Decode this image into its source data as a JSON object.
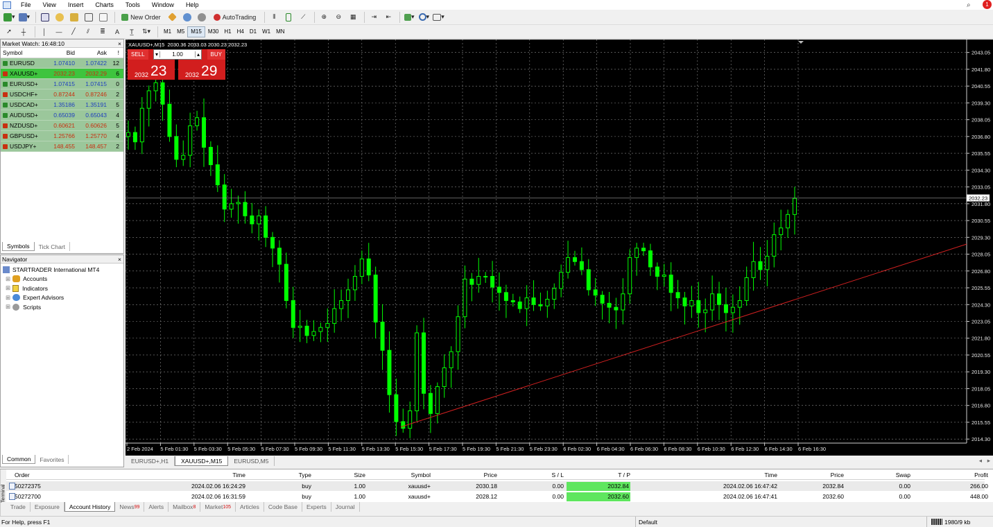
{
  "menu": [
    "File",
    "View",
    "Insert",
    "Charts",
    "Tools",
    "Window",
    "Help"
  ],
  "toolbar": {
    "new_order": "New Order",
    "autotrading": "AutoTrading"
  },
  "drawing_tools": {
    "text_tool": "A"
  },
  "timeframes": [
    "M1",
    "M5",
    "M15",
    "M30",
    "H1",
    "H4",
    "D1",
    "W1",
    "MN"
  ],
  "market_watch": {
    "title": "Market Watch: 16:48:10",
    "columns": [
      "Symbol",
      "Bid",
      "Ask",
      "!"
    ],
    "rows": [
      {
        "symbol": "EURUSD",
        "bid": "1.07410",
        "ask": "1.07422",
        "spread": "12",
        "bidc": "#1f3fbf",
        "askc": "#1f3fbf",
        "hl": false
      },
      {
        "symbol": "XAUUSD+",
        "bid": "2032.23",
        "ask": "2032.29",
        "spread": "6",
        "bidc": "#c83010",
        "askc": "#c83010",
        "hl": true
      },
      {
        "symbol": "EURUSD+",
        "bid": "1.07415",
        "ask": "1.07415",
        "spread": "0",
        "bidc": "#1f3fbf",
        "askc": "#1f3fbf",
        "hl": false
      },
      {
        "symbol": "USDCHF+",
        "bid": "0.87244",
        "ask": "0.87246",
        "spread": "2",
        "bidc": "#c83010",
        "askc": "#c83010",
        "hl": false
      },
      {
        "symbol": "USDCAD+",
        "bid": "1.35186",
        "ask": "1.35191",
        "spread": "5",
        "bidc": "#1f3fbf",
        "askc": "#1f3fbf",
        "hl": false
      },
      {
        "symbol": "AUDUSD+",
        "bid": "0.65039",
        "ask": "0.65043",
        "spread": "4",
        "bidc": "#1f3fbf",
        "askc": "#1f3fbf",
        "hl": false
      },
      {
        "symbol": "NZDUSD+",
        "bid": "0.60621",
        "ask": "0.60626",
        "spread": "5",
        "bidc": "#c83010",
        "askc": "#c83010",
        "hl": false
      },
      {
        "symbol": "GBPUSD+",
        "bid": "1.25766",
        "ask": "1.25770",
        "spread": "4",
        "bidc": "#c83010",
        "askc": "#c83010",
        "hl": false
      },
      {
        "symbol": "USDJPY+",
        "bid": "148.455",
        "ask": "148.457",
        "spread": "2",
        "bidc": "#c83010",
        "askc": "#c83010",
        "hl": false
      }
    ],
    "tabs": [
      "Symbols",
      "Tick Chart"
    ]
  },
  "navigator": {
    "title": "Navigator",
    "root": "STARTRADER International MT4",
    "items": [
      "Accounts",
      "Indicators",
      "Expert Advisors",
      "Scripts"
    ],
    "tabs": [
      "Common",
      "Favorites"
    ]
  },
  "chart": {
    "header": "XAUUSD+,M15  2030.36 2033.03 2030.23 2032.23",
    "sell_label": "SELL",
    "buy_label": "BUY",
    "lot": "1.00",
    "sell_prefix": "2032",
    "sell_big": "23",
    "buy_prefix": "2032",
    "buy_big": "29",
    "current_price": "2032.23",
    "colors": {
      "bg": "#000000",
      "candle": "#00ff00",
      "grid": "#808080",
      "trend": "#ff2020"
    }
  },
  "chart_data": {
    "type": "line",
    "series": [
      {
        "values": [
          2037.1,
          2036.4,
          2038.9,
          2040.2,
          2040.8,
          2039.2,
          2036.8,
          2035.1,
          2035.4,
          2037.6,
          2038.2,
          2036.0,
          2034.7,
          2033.2,
          2031.4,
          2031.8,
          2031.9,
          2030.9,
          2030.3,
          2030.9,
          2029.3,
          2028.5,
          2027.3,
          2024.6,
          2022.6,
          2022.7,
          2022.0,
          2022.3,
          2022.6,
          2022.9,
          2024.0,
          2024.6,
          2025.4,
          2026.4,
          2027.7,
          2026.5,
          2023.0,
          2020.9,
          2017.6,
          2015.6,
          2015.1,
          2016.4,
          2022.2,
          2017.7,
          2016.2,
          2018.2,
          2019.6,
          2020.8,
          2023.4,
          2026.2,
          2025.8,
          2026.4,
          2026.4,
          2025.6,
          2025.2,
          2024.6,
          2024.5,
          2024.0,
          2024.8,
          2024.3,
          2024.2,
          2024.7,
          2025.5,
          2026.7,
          2027.8,
          2027.5,
          2026.9,
          2025.4,
          2025.0,
          2024.4,
          2024.1,
          2023.9,
          2025.1,
          2027.8,
          2028.5,
          2028.3,
          2027.1,
          2026.4,
          2026.5,
          2025.2,
          2024.8,
          2024.2,
          2024.6,
          2023.7,
          2023.9,
          2025.1,
          2024.3,
          2023.7,
          2024.1,
          2024.6,
          2026.3,
          2027.5,
          2026.9,
          2027.9,
          2029.5,
          2030.0,
          2031.0,
          2032.2
        ]
      }
    ],
    "x_ticks": [
      "2 Feb 2024",
      "5 Feb 01:30",
      "5 Feb 03:30",
      "5 Feb 05:30",
      "5 Feb 07:30",
      "5 Feb 09:30",
      "5 Feb 11:30",
      "5 Feb 13:30",
      "5 Feb 15:30",
      "5 Feb 17:30",
      "5 Feb 19:30",
      "5 Feb 21:30",
      "5 Feb 23:30",
      "6 Feb 02:30",
      "6 Feb 04:30",
      "6 Feb 06:30",
      "6 Feb 08:30",
      "6 Feb 10:30",
      "6 Feb 12:30",
      "6 Feb 14:30",
      "6 Feb 16:30"
    ],
    "y_ticks": [
      "2043.05",
      "2041.80",
      "2040.55",
      "2039.30",
      "2038.05",
      "2036.80",
      "2035.55",
      "2034.30",
      "2033.05",
      "2031.80",
      "2030.55",
      "2029.30",
      "2028.05",
      "2026.80",
      "2025.55",
      "2024.30",
      "2023.05",
      "2021.80",
      "2020.55",
      "2019.30",
      "2018.05",
      "2016.80",
      "2015.55",
      "2014.30"
    ],
    "ylim": [
      2014.0,
      2043.6
    ]
  },
  "chart_tabs": [
    "EURUSD+,H1",
    "XAUUSD+,M15",
    "EURUSD,M5"
  ],
  "terminal": {
    "side": "Terminal",
    "columns": [
      "Order",
      "Time",
      "Type",
      "Size",
      "Symbol",
      "Price",
      "S / L",
      "T / P",
      "Time",
      "Price",
      "Swap",
      "Profit"
    ],
    "rows": [
      [
        "50272375",
        "2024.02.06 16:24:29",
        "buy",
        "1.00",
        "xauusd+",
        "2030.18",
        "0.00",
        "2032.84",
        "2024.02.06 16:47:42",
        "2032.84",
        "0.00",
        "266.00"
      ],
      [
        "50272700",
        "2024.02.06 16:31:59",
        "buy",
        "1.00",
        "xauusd+",
        "2028.12",
        "0.00",
        "2032.60",
        "2024.02.06 16:47:41",
        "2032.60",
        "0.00",
        "448.00"
      ]
    ],
    "tabs": [
      {
        "label": "Trade",
        "badge": ""
      },
      {
        "label": "Exposure",
        "badge": ""
      },
      {
        "label": "Account History",
        "badge": ""
      },
      {
        "label": "News",
        "badge": "99"
      },
      {
        "label": "Alerts",
        "badge": ""
      },
      {
        "label": "Mailbox",
        "badge": "8"
      },
      {
        "label": "Market",
        "badge": "105"
      },
      {
        "label": "Articles",
        "badge": ""
      },
      {
        "label": "Code Base",
        "badge": ""
      },
      {
        "label": "Experts",
        "badge": ""
      },
      {
        "label": "Journal",
        "badge": ""
      }
    ]
  },
  "status": {
    "help": "For Help, press F1",
    "profile": "Default",
    "traffic": "1980/9 kb"
  },
  "notification_count": "1"
}
